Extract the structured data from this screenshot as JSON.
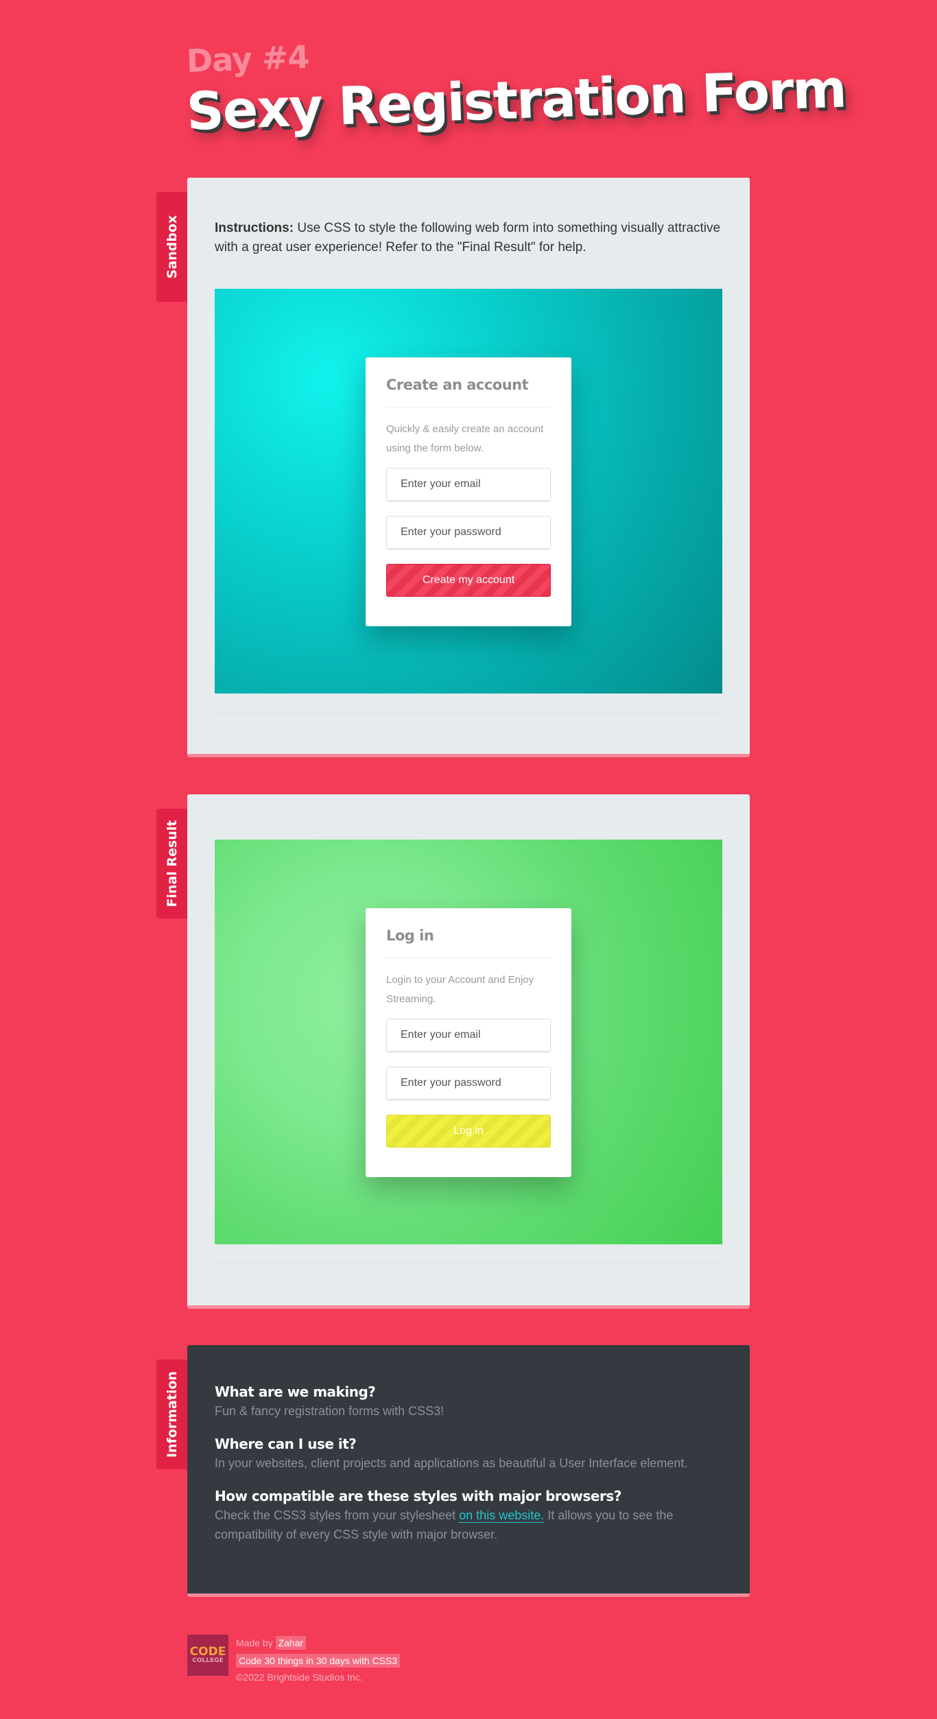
{
  "header": {
    "day": "Day #4",
    "title": "Sexy Registration Form"
  },
  "sandbox": {
    "tab_label": "Sandbox",
    "instructions_bold": "Instructions:",
    "instructions_text": " Use CSS to style the following web form into something visually attractive with a great user experience! Refer to the \"Final Result\" for help.",
    "form": {
      "title": "Create an account",
      "description": "Quickly & easily create an account using the form below.",
      "email_placeholder": "Enter your email",
      "password_placeholder": "Enter your password",
      "submit_label": "Create my account"
    }
  },
  "final": {
    "tab_label": "Final Result",
    "form": {
      "title": "Log in",
      "description": "Login to your Account and Enjoy Streaming.",
      "email_placeholder": "Enter your email",
      "password_placeholder": "Enter your password",
      "submit_label": "Log in"
    }
  },
  "information": {
    "tab_label": "Information",
    "q1": "What are we making?",
    "a1": "Fun & fancy registration forms with CSS3!",
    "q2": "Where can I use it?",
    "a2": "In your websites, client projects and applications as beautiful a User Interface element.",
    "q3": "How compatible are these styles with major browsers?",
    "a3_before": "Check the CSS3 styles from your stylesheet ",
    "a3_link": "on this website.",
    "a3_after": " It allows you to see the compatibility of every CSS style with major browser."
  },
  "footer": {
    "logo_line1": "CODE",
    "logo_line2": "COLLEGE",
    "made_by": "Made by",
    "author": "Zahar",
    "course": "Code 30 things in 30 days with CSS3",
    "copyright": "©2022 Brightside Studios Inc."
  },
  "colors": {
    "background": "#f43c58",
    "tab": "#e12245",
    "accent_cyan": "#12f2ec",
    "accent_green": "#7ce98e",
    "button_red": "#f24560",
    "button_yellow": "#f1ef3f",
    "info_panel": "#343a40"
  }
}
